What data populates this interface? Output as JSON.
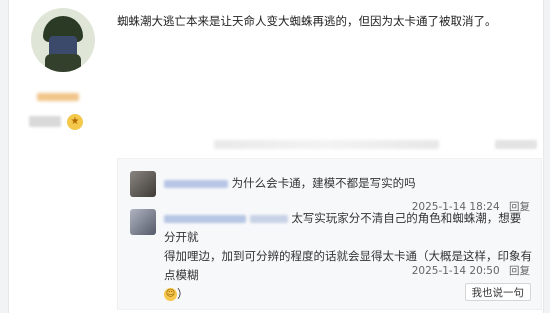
{
  "post": {
    "text": "蜘蛛潮大逃亡本来是让天命人变大蜘蛛再逃的，但因为太卡通了被取消了。"
  },
  "replies": [
    {
      "text": "为什么会卡通，建模不都是写实的吗",
      "date": "2025-1-14 18:24",
      "reply_label": "回复"
    },
    {
      "text_line1": "太写实玩家分不清自己的角色和蜘蛛潮，想要分开就",
      "text_line2": "得加哩边，加到可分辨的程度的话就会显得太卡通（大概是这样，印象有点模糊",
      "text_line3": "）",
      "date": "2025-1-14 20:50",
      "reply_label": "回复"
    }
  ],
  "say_button_label": "我也说一句",
  "medal_icon": "medal-icon",
  "emoji_icon": "smile-emoji-icon"
}
